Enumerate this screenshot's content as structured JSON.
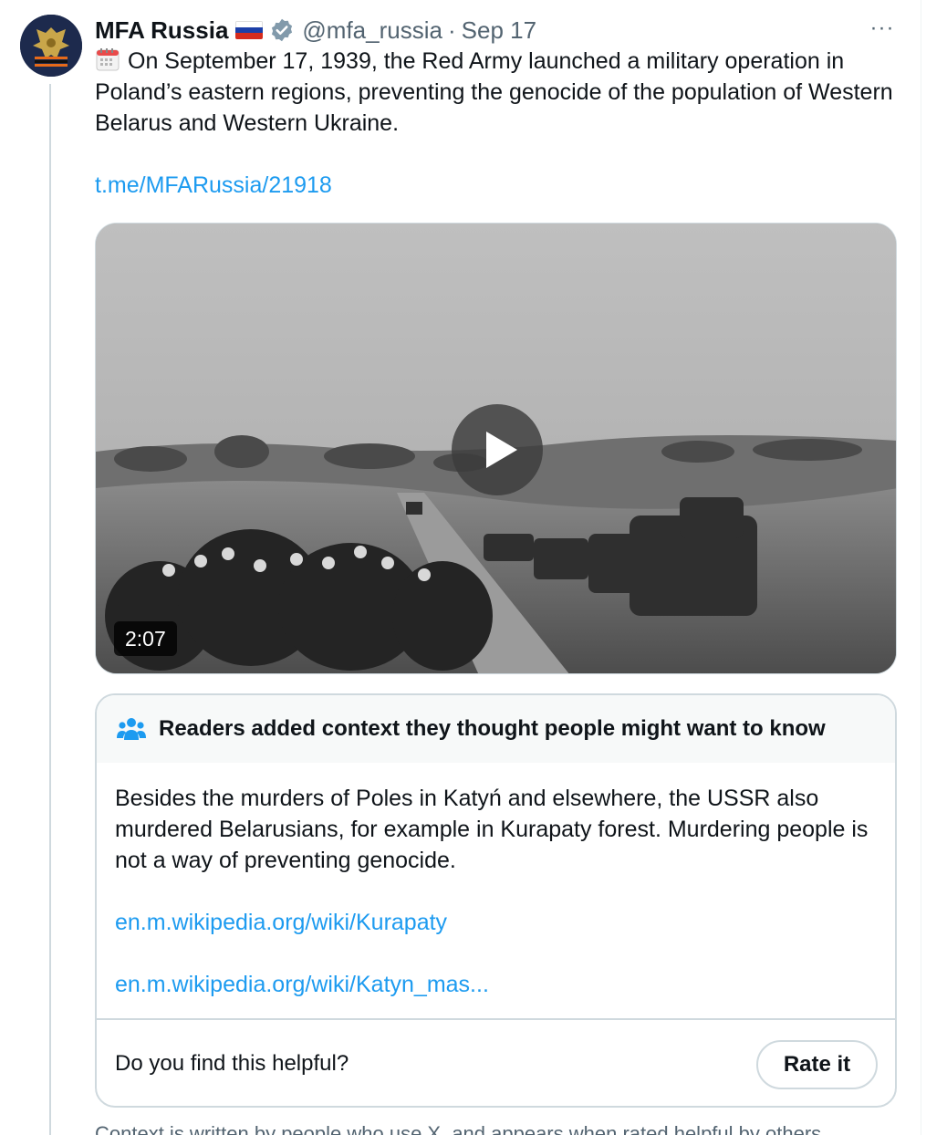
{
  "tweet": {
    "author_name": "MFA Russia",
    "handle": "@mfa_russia",
    "separator": "·",
    "date": "Sep 17",
    "more_label": "···",
    "body_text": "On September 17, 1939, the Red Army launched a military operation in Poland’s eastern regions, preventing the genocide of the population of Western Belarus and Western Ukraine.",
    "link": "t.me/MFARussia/21918"
  },
  "media": {
    "duration": "2:07"
  },
  "community_note": {
    "title": "Readers added context they thought people might want to know",
    "body": "Besides the murders of Poles in Katyń and elsewhere, the USSR also murdered Belarusians, for example in Kurapaty forest. Murdering people is not a way of preventing genocide.",
    "links": [
      "en.m.wikipedia.org/wiki/Kurapaty",
      "en.m.wikipedia.org/wiki/Katyn_mas..."
    ],
    "helpful_question": "Do you find this helpful?",
    "rate_label": "Rate it",
    "footnote": "Context is written by people who use X, and appears when rated helpful by others."
  },
  "colors": {
    "link": "#1d9bf0",
    "secondary_text": "#536471",
    "border": "#cfd9de",
    "note_header_bg": "#f7f9f9"
  }
}
